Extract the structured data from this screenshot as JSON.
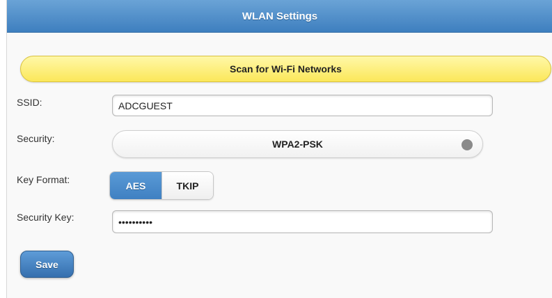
{
  "header": {
    "title": "WLAN Settings"
  },
  "scan": {
    "label": "Scan for Wi-Fi Networks"
  },
  "form": {
    "ssid": {
      "label": "SSID:",
      "value": "ADCGUEST"
    },
    "security": {
      "label": "Security:",
      "value": "WPA2-PSK"
    },
    "key_format": {
      "label": "Key Format:",
      "options": [
        "AES",
        "TKIP"
      ],
      "selected": "AES"
    },
    "security_key": {
      "label": "Security Key:",
      "value": "••••••••••"
    }
  },
  "actions": {
    "save_label": "Save"
  },
  "colors": {
    "header": "#4a8bca",
    "scan_button": "#fbe75a",
    "active_segment": "#4a8bca",
    "save_button": "#3f7fc0"
  }
}
